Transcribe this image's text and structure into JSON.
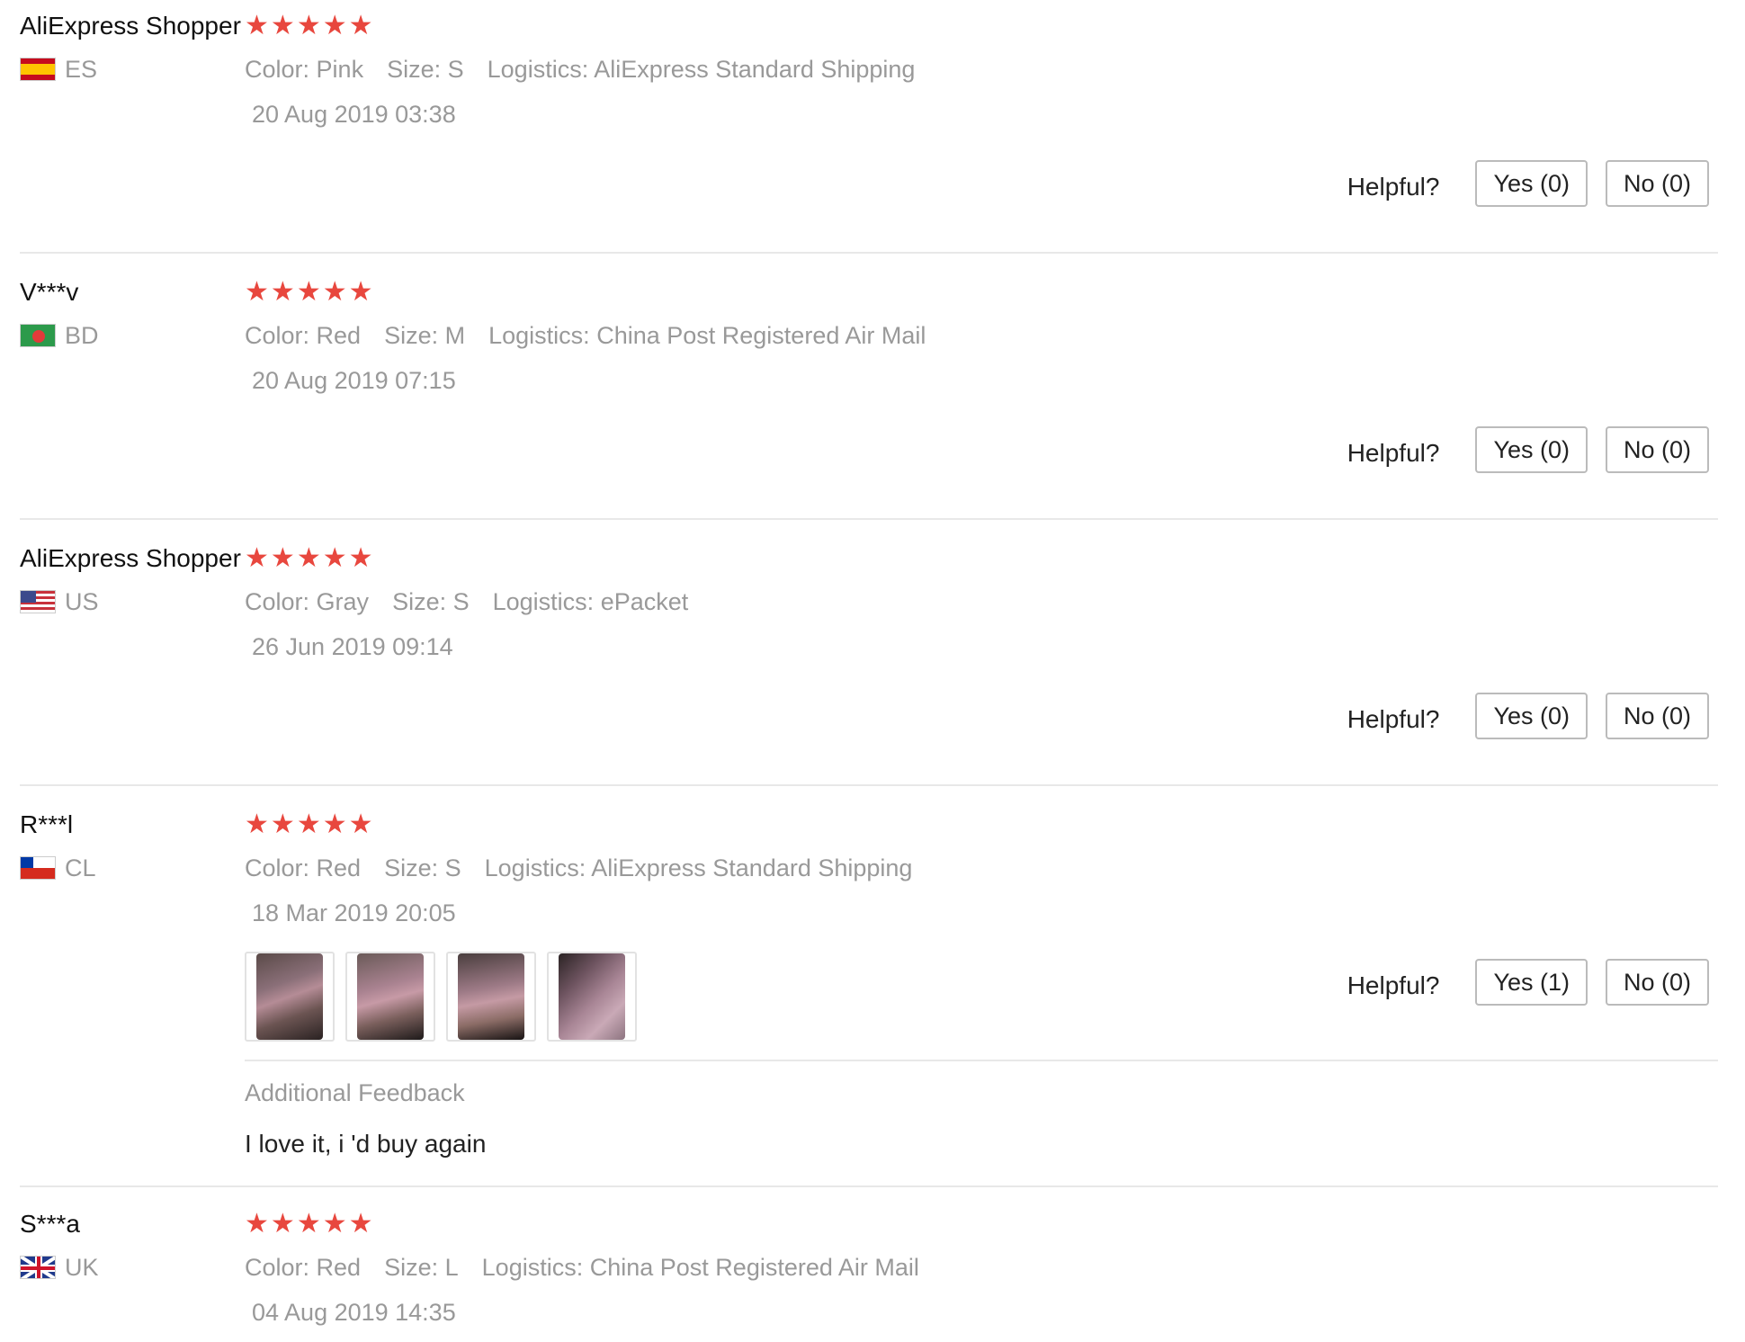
{
  "reviews": [
    {
      "user": "AliExpress Shopper",
      "country": "ES",
      "rating": 5,
      "color_label": "Color:",
      "color": "Pink",
      "size_label": "Size:",
      "size": "S",
      "logistics_label": "Logistics:",
      "logistics": "AliExpress Standard Shipping",
      "date": "20 Aug 2019 03:38",
      "helpful_label": "Helpful?",
      "yes_label": "Yes (0)",
      "no_label": "No (0)"
    },
    {
      "user": "V***v",
      "country": "BD",
      "rating": 5,
      "color_label": "Color:",
      "color": "Red",
      "size_label": "Size:",
      "size": "M",
      "logistics_label": "Logistics:",
      "logistics": "China Post Registered Air Mail",
      "date": "20 Aug 2019 07:15",
      "helpful_label": "Helpful?",
      "yes_label": "Yes (0)",
      "no_label": "No (0)"
    },
    {
      "user": "AliExpress Shopper",
      "country": "US",
      "rating": 5,
      "color_label": "Color:",
      "color": "Gray",
      "size_label": "Size:",
      "size": "S",
      "logistics_label": "Logistics:",
      "logistics": "ePacket",
      "date": "26 Jun 2019 09:14",
      "helpful_label": "Helpful?",
      "yes_label": "Yes (0)",
      "no_label": "No (0)"
    },
    {
      "user": "R***l",
      "country": "CL",
      "rating": 5,
      "color_label": "Color:",
      "color": "Red",
      "size_label": "Size:",
      "size": "S",
      "logistics_label": "Logistics:",
      "logistics": "AliExpress Standard Shipping",
      "date": "18 Mar 2019 20:05",
      "helpful_label": "Helpful?",
      "yes_label": "Yes (1)",
      "no_label": "No (0)",
      "photos": [
        "photo-1",
        "photo-2",
        "photo-3",
        "photo-4"
      ],
      "additional_feedback_title": "Additional Feedback",
      "additional_feedback_text": "I love it, i 'd buy again"
    },
    {
      "user": "S***a",
      "country": "UK",
      "rating": 5,
      "color_label": "Color:",
      "color": "Red",
      "size_label": "Size:",
      "size": "L",
      "logistics_label": "Logistics:",
      "logistics": "China Post Registered Air Mail",
      "date": "04 Aug 2019 14:35"
    }
  ],
  "colors": {
    "star": "#e8473e",
    "muted_text": "#999999",
    "divider": "#e8e8e8"
  },
  "icons": {
    "star": "star-icon",
    "flag": "country-flag-icon"
  }
}
